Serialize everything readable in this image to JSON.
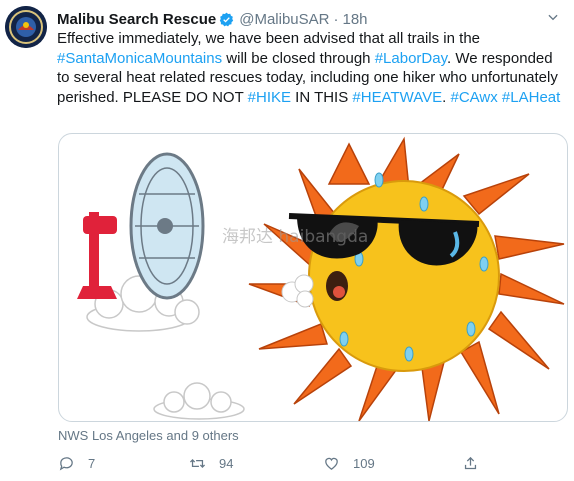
{
  "tweet": {
    "author_name": "Malibu Search Rescue",
    "handle": "@MalibuSAR",
    "separator": "·",
    "time": "18h",
    "text_parts": [
      {
        "text": "Effective immediately, we have been advised that all trails in the ",
        "hashtag": false
      },
      {
        "text": "#SantaMonicaMountains",
        "hashtag": true
      },
      {
        "text": " will be closed through ",
        "hashtag": false
      },
      {
        "text": "#LaborDay",
        "hashtag": true
      },
      {
        "text": ". We responded to several heat related rescues today, including one hiker who unfortunately perished.  PLEASE DO NOT ",
        "hashtag": false
      },
      {
        "text": "#HIKE",
        "hashtag": true
      },
      {
        "text": " IN THIS ",
        "hashtag": false
      },
      {
        "text": "#HEATWAVE",
        "hashtag": true
      },
      {
        "text": ". ",
        "hashtag": false
      },
      {
        "text": "#CAwx",
        "hashtag": true
      },
      {
        "text": " ",
        "hashtag": false
      },
      {
        "text": "#LAHeat",
        "hashtag": true
      }
    ],
    "watermark": "海邦达 haibangda"
  },
  "liked_by": "NWS Los Angeles and 9 others",
  "actions": {
    "reply_count": "7",
    "retweet_count": "94",
    "like_count": "109"
  },
  "icons": [
    "verified-icon",
    "chevron-down-icon",
    "reply-icon",
    "retweet-icon",
    "like-icon",
    "share-icon"
  ],
  "colors": {
    "hashtag": "#1da1f2",
    "muted": "#657786",
    "sun": "#f7c21c",
    "rays": "#f26a1b"
  }
}
